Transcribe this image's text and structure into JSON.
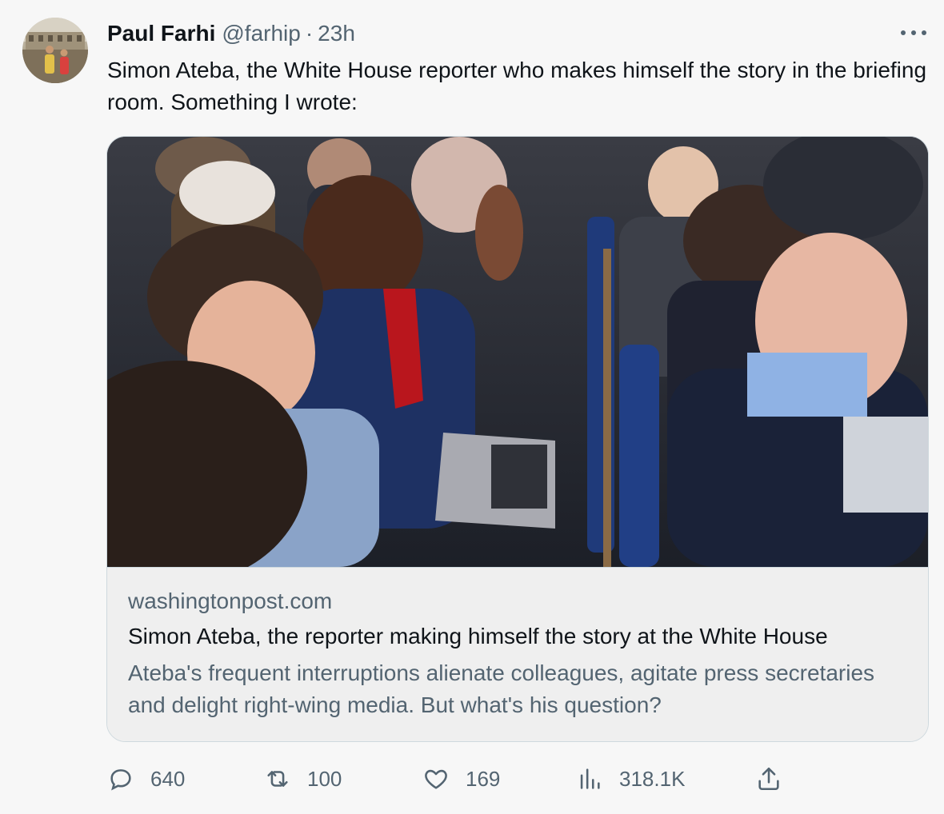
{
  "author": {
    "name": "Paul Farhi",
    "handle": "@farhip",
    "separator": "·",
    "time": "23h"
  },
  "tweet": {
    "text": "Simon Ateba, the White House reporter who makes himself the story in the briefing room. Something I wrote:"
  },
  "card": {
    "domain": "washingtonpost.com",
    "title": "Simon Ateba, the reporter making himself the story at the White House",
    "description": "Ateba's frequent interruptions alienate colleagues, agitate press secretaries and delight right-wing media. But what's his question?"
  },
  "actions": {
    "replies": "640",
    "retweets": "100",
    "likes": "169",
    "views": "318.1K"
  },
  "icons": [
    "more-icon",
    "reply-icon",
    "retweet-icon",
    "like-icon",
    "views-icon",
    "share-icon"
  ],
  "colors": {
    "text_primary": "#0f1419",
    "text_secondary": "#536471",
    "border": "#cfd9de",
    "background": "#f7f7f7"
  }
}
